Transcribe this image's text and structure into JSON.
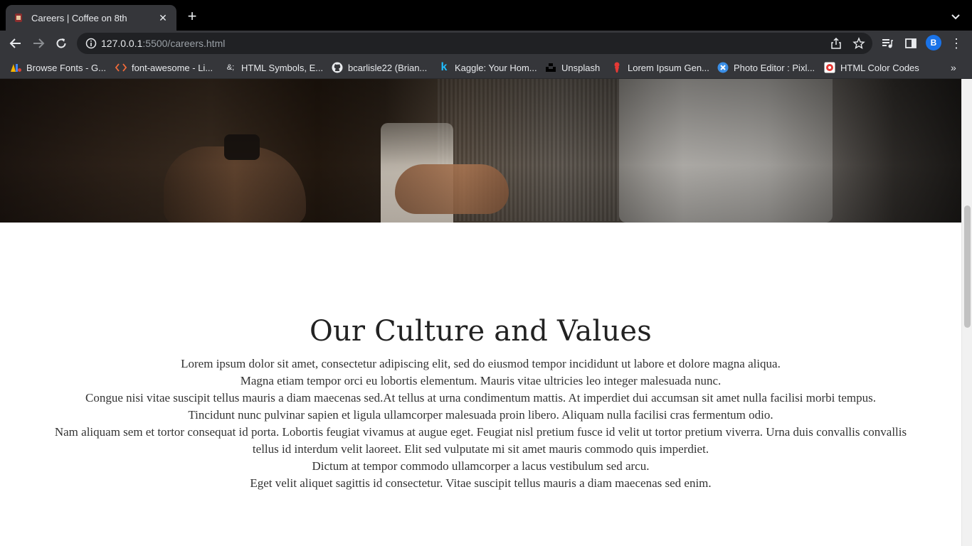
{
  "browser": {
    "tab_title": "Careers | Coffee on 8th",
    "new_tab_symbol": "+",
    "url_host": "127.0.0.1",
    "url_rest": ":5500/careers.html",
    "profile_initial": "B"
  },
  "bookmarks": [
    {
      "label": "Browse Fonts - G...",
      "icon": "google-fonts-icon"
    },
    {
      "label": "font-awesome - Li...",
      "icon": "code-icon"
    },
    {
      "label": "HTML Symbols, E...",
      "icon": "ampersand-icon"
    },
    {
      "label": "bcarlisle22 (Brian...",
      "icon": "github-icon"
    },
    {
      "label": "Kaggle: Your Hom...",
      "icon": "kaggle-icon"
    },
    {
      "label": "Unsplash",
      "icon": "unsplash-icon"
    },
    {
      "label": "Lorem Ipsum Gen...",
      "icon": "lorem-ipsum-icon"
    },
    {
      "label": "Photo Editor : Pixl...",
      "icon": "pixlr-icon"
    },
    {
      "label": "HTML Color Codes",
      "icon": "color-codes-icon"
    }
  ],
  "bookmarks_more": "»",
  "culture": {
    "title": "Our Culture and Values",
    "lines": [
      "Lorem ipsum dolor sit amet, consectetur adipiscing elit, sed do eiusmod tempor incididunt ut labore et dolore magna aliqua.",
      "Magna etiam tempor orci eu lobortis elementum. Mauris vitae ultricies leo integer malesuada nunc.",
      "Congue nisi vitae suscipit tellus mauris a diam maecenas sed.At tellus at urna condimentum mattis. At imperdiet dui accumsan sit amet nulla facilisi morbi tempus.",
      "Tincidunt nunc pulvinar sapien et ligula ullamcorper malesuada proin libero. Aliquam nulla facilisi cras fermentum odio.",
      "Nam aliquam sem et tortor consequat id porta. Lobortis feugiat vivamus at augue eget. Feugiat nisl pretium fusce id velit ut tortor pretium viverra. Urna duis convallis convallis tellus id interdum velit laoreet. Elit sed vulputate mi sit amet mauris commodo quis imperdiet.",
      "Dictum at tempor commodo ullamcorper a lacus vestibulum sed arcu.",
      "Eget velit aliquet sagittis id consectetur. Vitae suscipit tellus mauris a diam maecenas sed enim."
    ]
  }
}
